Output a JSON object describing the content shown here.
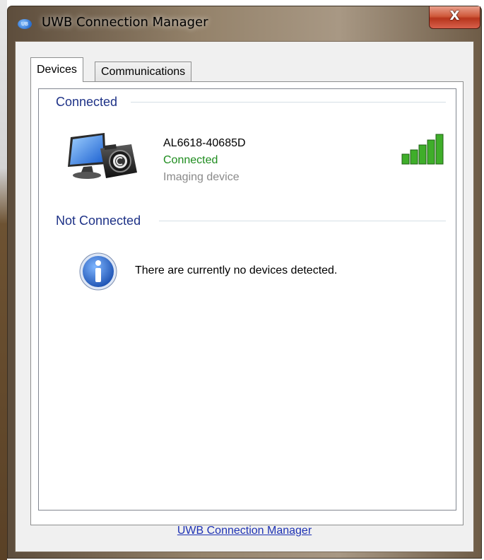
{
  "window": {
    "title": "UWB Connection Manager",
    "close_symbol": "X",
    "app_icon_text": "UB"
  },
  "tabs": [
    {
      "label": "Devices",
      "active": true
    },
    {
      "label": "Communications",
      "active": false
    }
  ],
  "sections": {
    "connected_header": "Connected",
    "not_connected_header": "Not Connected"
  },
  "device": {
    "name": "AL6618-40685D",
    "status": "Connected",
    "type": "Imaging device",
    "icon": "monitor-camera-icon",
    "signal_bars": 5,
    "signal_max": 5
  },
  "empty_message": "There are currently no devices detected.",
  "footer_link": "UWB Connection Manager",
  "colors": {
    "section_header": "#1e3287",
    "status_connected": "#1e8c1e",
    "device_type": "#8a8a8a",
    "link": "#1e32b4",
    "signal_green": "#3fae2a"
  }
}
